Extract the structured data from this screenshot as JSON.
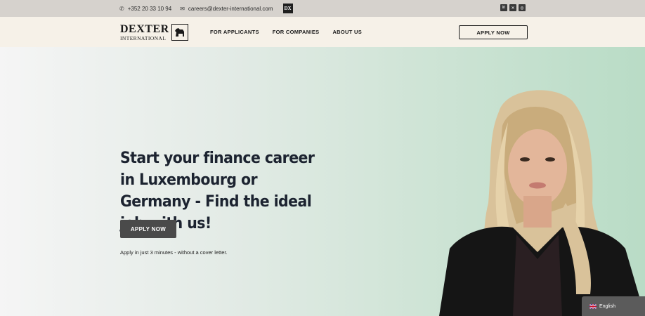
{
  "topbar": {
    "phone": "+352 20 33 10 94",
    "email": "careers@dexter-international.com",
    "dx_badge": "DX",
    "phone_icon": "phone-icon",
    "email_icon": "mail-icon",
    "social_icons": [
      "linkedin-icon",
      "xing-icon",
      "instagram-icon"
    ]
  },
  "nav": {
    "logo_line1": "DEXTER",
    "logo_line2": "INTERNATIONAL",
    "items": [
      {
        "label": "FOR APPLICANTS"
      },
      {
        "label": "FOR COMPANIES"
      },
      {
        "label": "ABOUT US"
      }
    ],
    "apply_label": "APPLY NOW"
  },
  "hero": {
    "headline": "Start your finance career in Luxembourg or Germany - Find the ideal job with us!",
    "apply_label": "APPLY NOW",
    "subtext": "Apply in just 3 minutes - without a cover letter."
  },
  "lang": {
    "label": "English",
    "flag_icon": "uk-flag-icon"
  },
  "colors": {
    "topbar_bg": "#d6d2cd",
    "nav_bg": "#f6f1e8",
    "hero_button_bg": "#4a4a4a",
    "hero_gradient_end": "#b9dcc6",
    "headline_color": "#1c2330"
  }
}
